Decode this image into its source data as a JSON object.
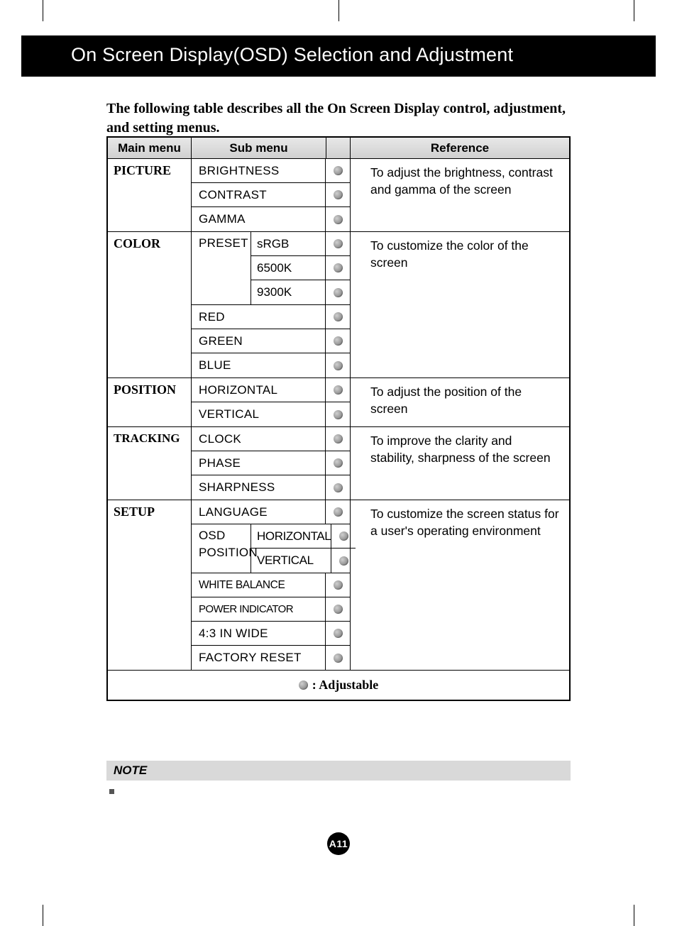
{
  "header": {
    "title": "On Screen Display(OSD) Selection and Adjustment"
  },
  "intro": "The following table describes all the On Screen Display control, adjustment, and setting menus.",
  "table": {
    "headers": {
      "main": "Main menu",
      "sub": "Sub menu",
      "ref": "Reference"
    },
    "legend": ": Adjustable",
    "sections": [
      {
        "main": "PICTURE",
        "ref": "To adjust the brightness, contrast and gamma of the screen",
        "rows": [
          {
            "sub": "BRIGHTNESS",
            "adj": true
          },
          {
            "sub": "CONTRAST",
            "adj": true
          },
          {
            "sub": "GAMMA",
            "adj": true
          }
        ]
      },
      {
        "main": "COLOR",
        "ref": "To customize the color of the screen",
        "preset_label": "PRESET",
        "preset_rows": [
          {
            "sub": "sRGB",
            "adj": true
          },
          {
            "sub": "6500K",
            "adj": true
          },
          {
            "sub": "9300K",
            "adj": true
          }
        ],
        "rows": [
          {
            "sub": "RED",
            "adj": true
          },
          {
            "sub": "GREEN",
            "adj": true
          },
          {
            "sub": "BLUE",
            "adj": true
          }
        ]
      },
      {
        "main": "POSITION",
        "ref": "To adjust the position of the screen",
        "rows": [
          {
            "sub": "HORIZONTAL",
            "adj": true
          },
          {
            "sub": "VERTICAL",
            "adj": true
          }
        ]
      },
      {
        "main": "TRACKING",
        "ref": "To improve the clarity and stability, sharpness of the screen",
        "rows": [
          {
            "sub": "CLOCK",
            "adj": true
          },
          {
            "sub": "PHASE",
            "adj": true
          },
          {
            "sub": "SHARPNESS",
            "adj": true
          }
        ]
      },
      {
        "main": "SETUP",
        "ref": "To customize the screen status for a user's operating environment",
        "pre_rows": [
          {
            "sub": "LANGUAGE",
            "adj": true
          }
        ],
        "osd_label1": "OSD",
        "osd_label2": "POSITION",
        "osd_rows": [
          {
            "sub": "HORIZONTAL",
            "adj": true
          },
          {
            "sub": "VERTICAL",
            "adj": true
          }
        ],
        "rows": [
          {
            "sub": "WHITE  BALANCE",
            "adj": true
          },
          {
            "sub": "POWER INDICATOR",
            "adj": true
          },
          {
            "sub": "4:3 IN WIDE",
            "adj": true
          },
          {
            "sub": "FACTORY RESET",
            "adj": true
          }
        ]
      }
    ]
  },
  "note": {
    "label": "NOTE",
    "body": ""
  },
  "footer": {
    "page": "A11"
  }
}
